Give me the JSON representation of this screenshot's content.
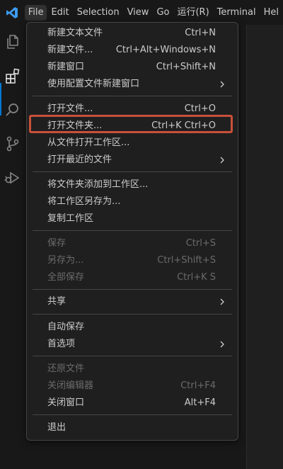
{
  "menubar": {
    "items": [
      "File",
      "Edit",
      "Selection",
      "View",
      "Go",
      "运行(R)",
      "Terminal",
      "Hel"
    ],
    "active_index": 0
  },
  "activity_bar": {
    "icons": [
      "explorer-icon",
      "extensions-icon",
      "search-icon",
      "source-control-icon",
      "run-debug-icon"
    ]
  },
  "file_menu": {
    "groups": [
      [
        {
          "label": "新建文本文件",
          "shortcut": "Ctrl+N",
          "enabled": true
        },
        {
          "label": "新建文件...",
          "shortcut": "Ctrl+Alt+Windows+N",
          "enabled": true
        },
        {
          "label": "新建窗口",
          "shortcut": "Ctrl+Shift+N",
          "enabled": true
        },
        {
          "label": "使用配置文件新建窗口",
          "shortcut": "",
          "enabled": true,
          "submenu": true
        }
      ],
      [
        {
          "label": "打开文件...",
          "shortcut": "Ctrl+O",
          "enabled": true
        },
        {
          "label": "打开文件夹...",
          "shortcut": "Ctrl+K Ctrl+O",
          "enabled": true,
          "highlighted": true
        },
        {
          "label": "从文件打开工作区...",
          "shortcut": "",
          "enabled": true
        },
        {
          "label": "打开最近的文件",
          "shortcut": "",
          "enabled": true,
          "submenu": true
        }
      ],
      [
        {
          "label": "将文件夹添加到工作区...",
          "shortcut": "",
          "enabled": true
        },
        {
          "label": "将工作区另存为...",
          "shortcut": "",
          "enabled": true
        },
        {
          "label": "复制工作区",
          "shortcut": "",
          "enabled": true
        }
      ],
      [
        {
          "label": "保存",
          "shortcut": "Ctrl+S",
          "enabled": false
        },
        {
          "label": "另存为...",
          "shortcut": "Ctrl+Shift+S",
          "enabled": false
        },
        {
          "label": "全部保存",
          "shortcut": "Ctrl+K S",
          "enabled": false
        }
      ],
      [
        {
          "label": "共享",
          "shortcut": "",
          "enabled": true,
          "submenu": true
        }
      ],
      [
        {
          "label": "自动保存",
          "shortcut": "",
          "enabled": true
        },
        {
          "label": "首选项",
          "shortcut": "",
          "enabled": true,
          "submenu": true
        }
      ],
      [
        {
          "label": "还原文件",
          "shortcut": "",
          "enabled": false
        },
        {
          "label": "关闭编辑器",
          "shortcut": "Ctrl+F4",
          "enabled": false
        },
        {
          "label": "关闭窗口",
          "shortcut": "Alt+F4",
          "enabled": true
        }
      ],
      [
        {
          "label": "退出",
          "shortcut": "",
          "enabled": true
        }
      ]
    ]
  },
  "colors": {
    "accent": "#0078d4",
    "highlight_box": "#c8503a",
    "menu_bg": "#1f1f1f",
    "text": "#cccccc",
    "disabled_text": "#6b6b6b"
  }
}
